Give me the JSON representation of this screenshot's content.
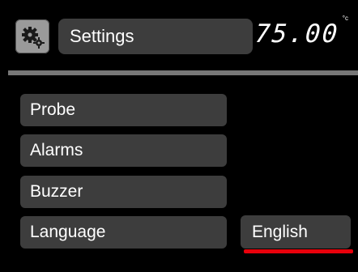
{
  "header": {
    "icon": "gears-icon",
    "title": "Settings",
    "temperature": "75.00",
    "unit": "°c"
  },
  "menu": {
    "items": [
      {
        "label": "Probe"
      },
      {
        "label": "Alarms"
      },
      {
        "label": "Buzzer"
      },
      {
        "label": "Language"
      }
    ]
  },
  "language_value": "English",
  "colors": {
    "background": "#000000",
    "panel": "#3d3d3d",
    "divider": "#777777",
    "accent": "#e8000b"
  }
}
